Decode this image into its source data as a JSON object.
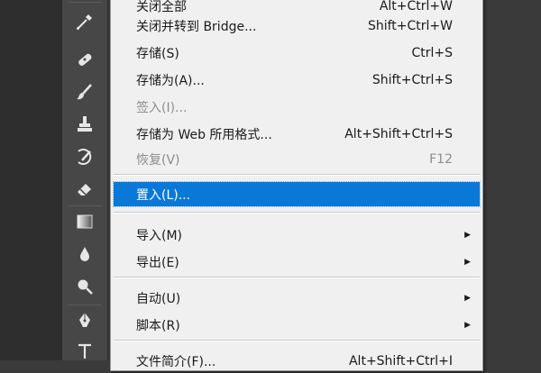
{
  "menu": {
    "items": [
      {
        "label": "关闭全部",
        "shortcut": "Alt+Ctrl+W"
      },
      {
        "label": "关闭并转到 Bridge...",
        "shortcut": "Shift+Ctrl+W"
      },
      {
        "label": "存储(S)",
        "shortcut": "Ctrl+S"
      },
      {
        "label": "存储为(A)...",
        "shortcut": "Shift+Ctrl+S"
      },
      {
        "label": "签入(I)...",
        "shortcut": ""
      },
      {
        "label": "存储为 Web 所用格式...",
        "shortcut": "Alt+Shift+Ctrl+S"
      },
      {
        "label": "恢复(V)",
        "shortcut": "F12"
      },
      {
        "label": "置入(L)...",
        "shortcut": ""
      },
      {
        "label": "导入(M)",
        "shortcut": "",
        "submenu": true
      },
      {
        "label": "导出(E)",
        "shortcut": "",
        "submenu": true
      },
      {
        "label": "自动(U)",
        "shortcut": "",
        "submenu": true
      },
      {
        "label": "脚本(R)",
        "shortcut": "",
        "submenu": true
      },
      {
        "label": "文件简介(F)...",
        "shortcut": "Alt+Shift+Ctrl+I"
      }
    ],
    "arrow_glyph": "▶"
  },
  "tools": [
    "eyedropper-icon",
    "healing-brush-icon",
    "brush-icon",
    "clone-stamp-icon",
    "history-brush-icon",
    "eraser-icon",
    "gradient-icon",
    "blur-icon",
    "dodge-icon",
    "pen-icon",
    "type-icon"
  ],
  "colors": {
    "selection": "#0a78d6",
    "menu_bg": "#f0f0f0",
    "disabled_text": "#8d8d8d",
    "toolbar_bg": "#474747"
  }
}
